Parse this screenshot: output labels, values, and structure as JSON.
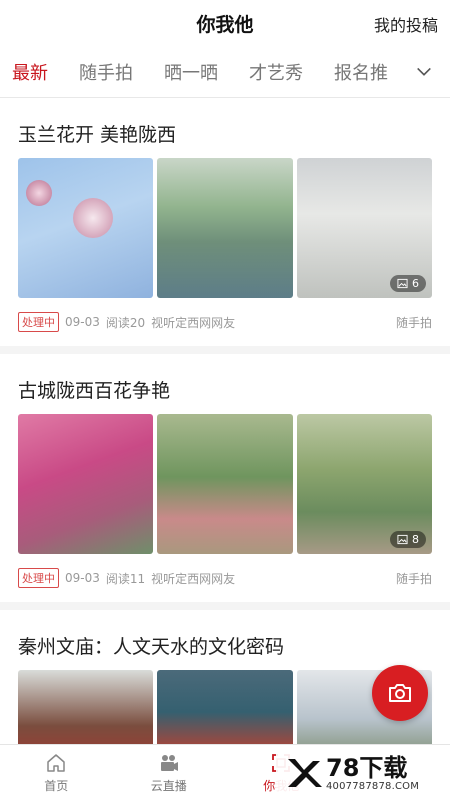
{
  "header": {
    "title": "你我他",
    "my_posts": "我的投稿"
  },
  "tabs": [
    {
      "label": "最新",
      "active": true
    },
    {
      "label": "随手拍",
      "active": false
    },
    {
      "label": "晒一晒",
      "active": false
    },
    {
      "label": "才艺秀",
      "active": false
    },
    {
      "label": "报名推",
      "active": false
    }
  ],
  "posts": [
    {
      "title": "玉兰花开 美艳陇西",
      "image_count": "6",
      "status": "处理中",
      "date": "09-03",
      "reads": "阅读20",
      "author": "视听定西网网友",
      "channel": "随手拍"
    },
    {
      "title": "古城陇西百花争艳",
      "image_count": "8",
      "status": "处理中",
      "date": "09-03",
      "reads": "阅读11",
      "author": "视听定西网网友",
      "channel": "随手拍"
    },
    {
      "title": "秦州文庙：人文天水的文化密码"
    }
  ],
  "bottom_nav": [
    {
      "label": "首页",
      "icon": "home-icon",
      "active": false
    },
    {
      "label": "云直播",
      "icon": "video-camera-icon",
      "active": false
    },
    {
      "label": "你我他",
      "icon": "scan-icon",
      "active": true
    }
  ],
  "watermark": {
    "brand": "78下载",
    "url": "4007787878.COM"
  },
  "colors": {
    "accent": "#c8161d",
    "fab": "#d81e22"
  }
}
